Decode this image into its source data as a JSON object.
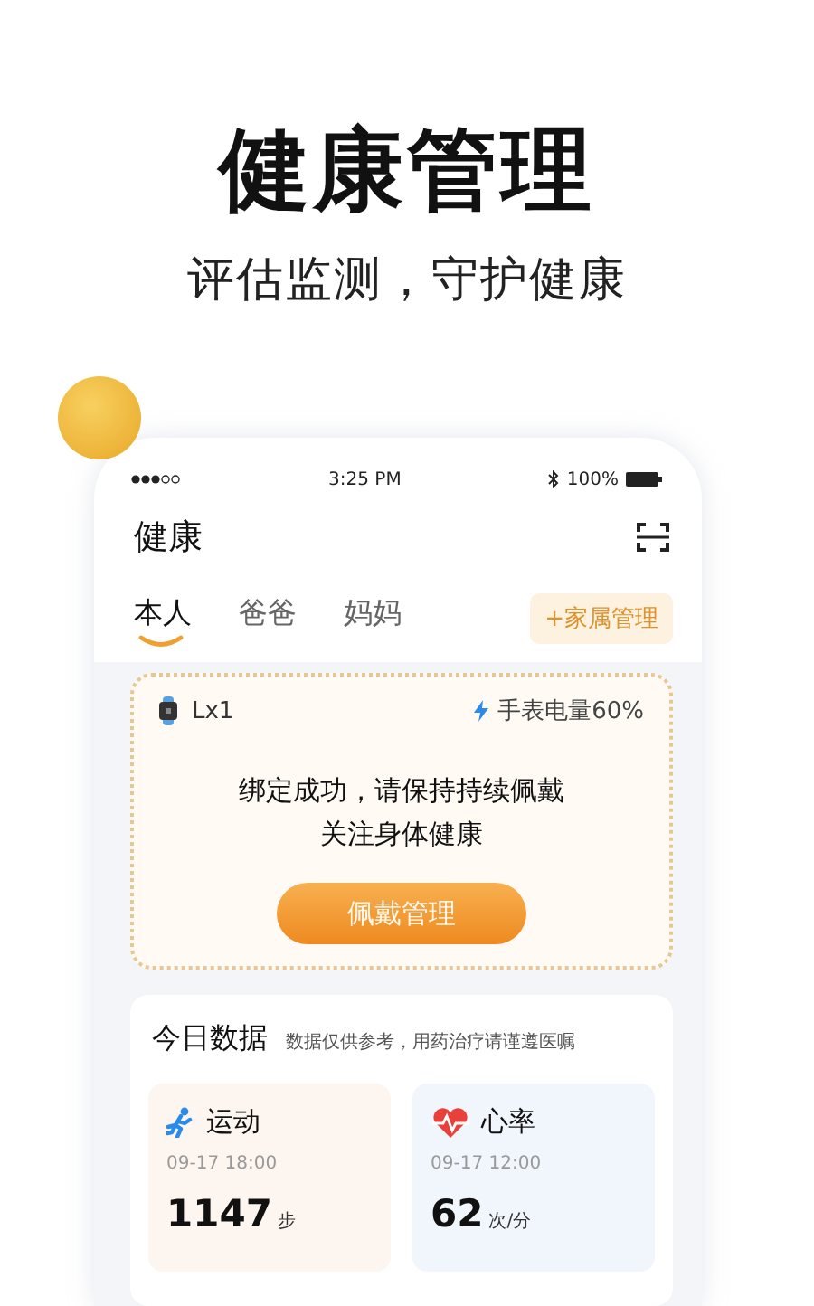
{
  "headline": "健康管理",
  "subtitle": "评估监测，守护健康",
  "status_bar": {
    "time": "3:25 PM",
    "battery": "100%"
  },
  "app_title": "健康",
  "tabs": [
    {
      "label": "本人",
      "selected": true
    },
    {
      "label": "爸爸",
      "selected": false
    },
    {
      "label": "妈妈",
      "selected": false
    }
  ],
  "family_button": "+家属管理",
  "device": {
    "name": "Lx1",
    "battery_text": "手表电量60%"
  },
  "message": [
    "绑定成功，请保持持续佩戴",
    "关注身体健康"
  ],
  "wear_button": "佩戴管理",
  "today": {
    "title": "今日数据",
    "note": "数据仅供参考，用药治疗请谨遵医嘱",
    "cards": [
      {
        "kind": "exercise",
        "title": "运动",
        "time": "09-17  18:00",
        "value": "1147",
        "unit": "步"
      },
      {
        "kind": "heart",
        "title": "心率",
        "time": "09-17  12:00",
        "value": "62",
        "unit": "次/分"
      }
    ]
  }
}
